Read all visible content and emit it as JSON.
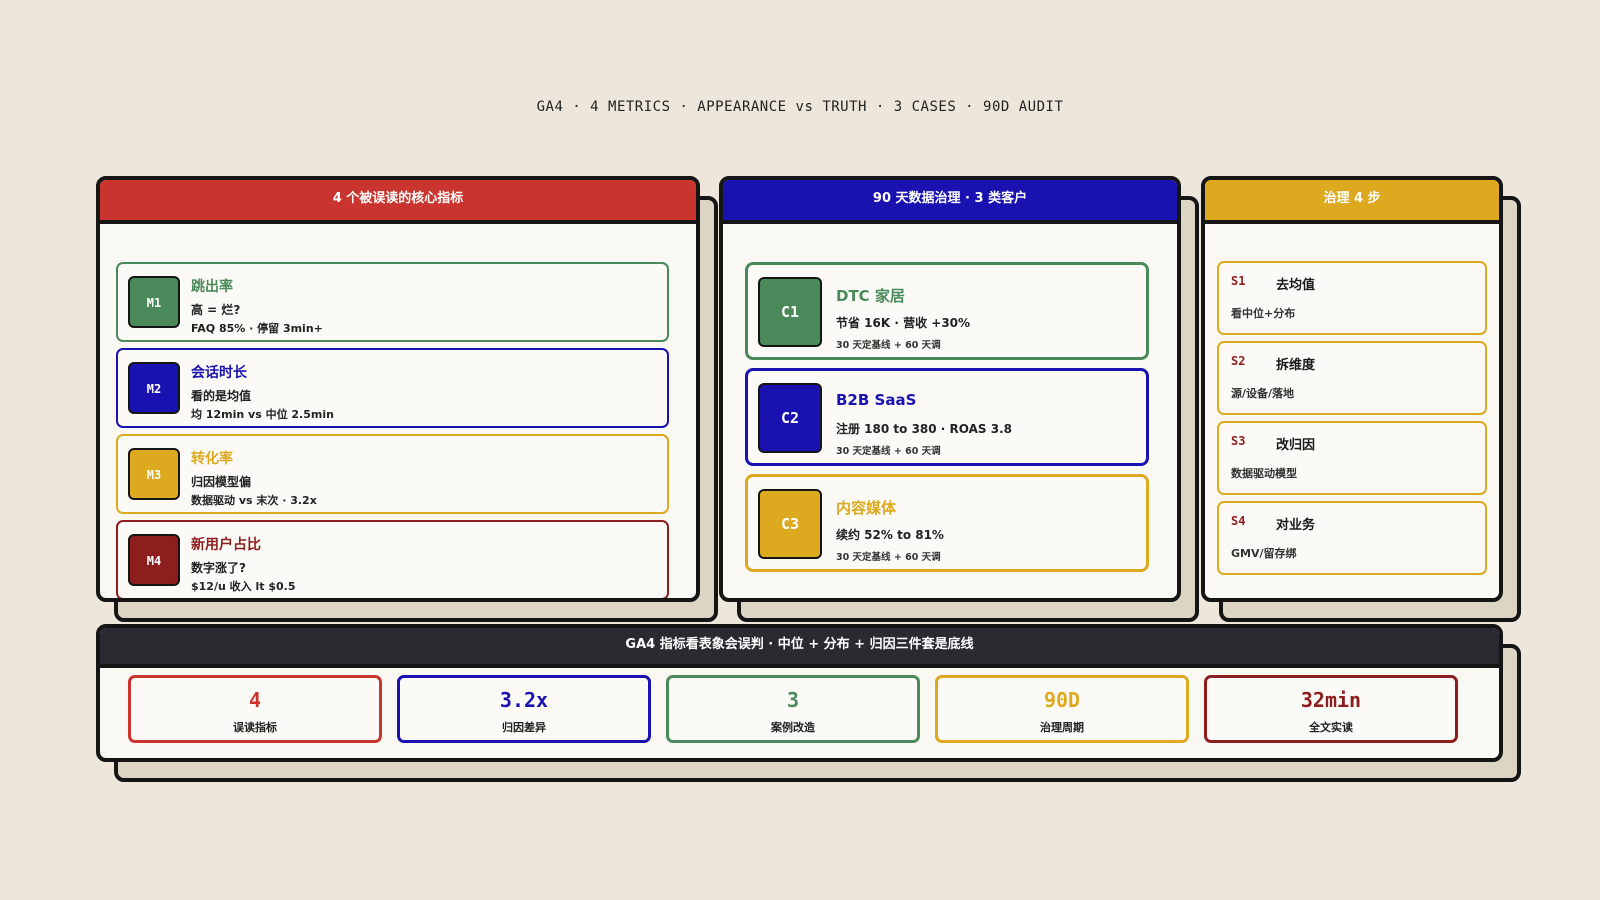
{
  "header": "GA4 · 4 METRICS · APPEARANCE vs TRUTH · 3 CASES · 90D AUDIT",
  "colors": {
    "red": "#c9352e",
    "blue": "#1a12b0",
    "gold": "#dca91f",
    "green": "#4a8a5a",
    "maroon": "#8c1e1e",
    "dark": "#2a2b31",
    "background": "#ece7da"
  },
  "metrics_panel": {
    "title": "4 个被误读的核心指标",
    "items": [
      {
        "id": "M1",
        "title": "跳出率",
        "sub": "高 = 烂?",
        "note": "FAQ 85% · 停留 3min+"
      },
      {
        "id": "M2",
        "title": "会话时长",
        "sub": "看的是均值",
        "note": "均 12min vs 中位 2.5min"
      },
      {
        "id": "M3",
        "title": "转化率",
        "sub": "归因模型偏",
        "note": "数据驱动 vs 末次 · 3.2x"
      },
      {
        "id": "M4",
        "title": "新用户占比",
        "sub": "数字涨了?",
        "note": "$12/u 收入 lt $0.5"
      }
    ]
  },
  "cases_panel": {
    "title": "90 天数据治理 · 3 类客户",
    "items": [
      {
        "id": "C1",
        "title": "DTC 家居",
        "sub": "节省 16K · 营收 +30%",
        "note": "30 天定基线 + 60 天调"
      },
      {
        "id": "C2",
        "title": "B2B SaaS",
        "sub": "注册 180 to 380 · ROAS 3.8",
        "note": "30 天定基线 + 60 天调"
      },
      {
        "id": "C3",
        "title": "内容媒体",
        "sub": "续约 52% to 81%",
        "note": "30 天定基线 + 60 天调"
      }
    ]
  },
  "steps_panel": {
    "title": "治理 4 步",
    "items": [
      {
        "id": "S1",
        "title": "去均值",
        "desc": "看中位+分布"
      },
      {
        "id": "S2",
        "title": "拆维度",
        "desc": "源/设备/落地"
      },
      {
        "id": "S3",
        "title": "改归因",
        "desc": "数据驱动模型"
      },
      {
        "id": "S4",
        "title": "对业务",
        "desc": "GMV/留存绑"
      }
    ]
  },
  "summary_panel": {
    "title": "GA4 指标看表象会误判 · 中位 + 分布 + 归因三件套是底线",
    "stats": [
      {
        "value": "4",
        "label": "误读指标"
      },
      {
        "value": "3.2x",
        "label": "归因差异"
      },
      {
        "value": "3",
        "label": "案例改造"
      },
      {
        "value": "90D",
        "label": "治理周期"
      },
      {
        "value": "32min",
        "label": "全文实读"
      }
    ]
  }
}
